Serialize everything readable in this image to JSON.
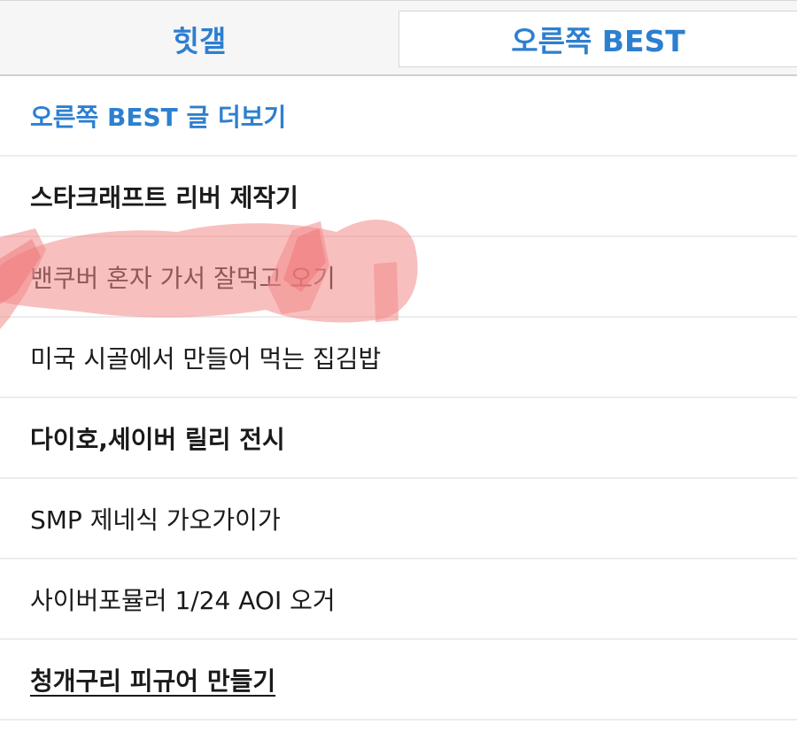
{
  "tabs": [
    {
      "label": "힛갤"
    },
    {
      "label": "오른쪽 BEST"
    }
  ],
  "more_link": "오른쪽 BEST 글 더보기",
  "items": [
    {
      "title": "스타크래프트 리버 제작기"
    },
    {
      "title": "밴쿠버 혼자 가서 잘먹고 오기"
    },
    {
      "title": "미국 시골에서 만들어 먹는 집김밥"
    },
    {
      "title": "다이호,세이버 릴리 전시"
    },
    {
      "title": "SMP 제네식 가오가이가"
    },
    {
      "title": "사이버포뮬러 1/24 AOI 오거"
    },
    {
      "title": "청개구리 피규어 만들기"
    }
  ],
  "colors": {
    "accent": "#2d7fd0",
    "highlight": "#f4a0a0"
  }
}
